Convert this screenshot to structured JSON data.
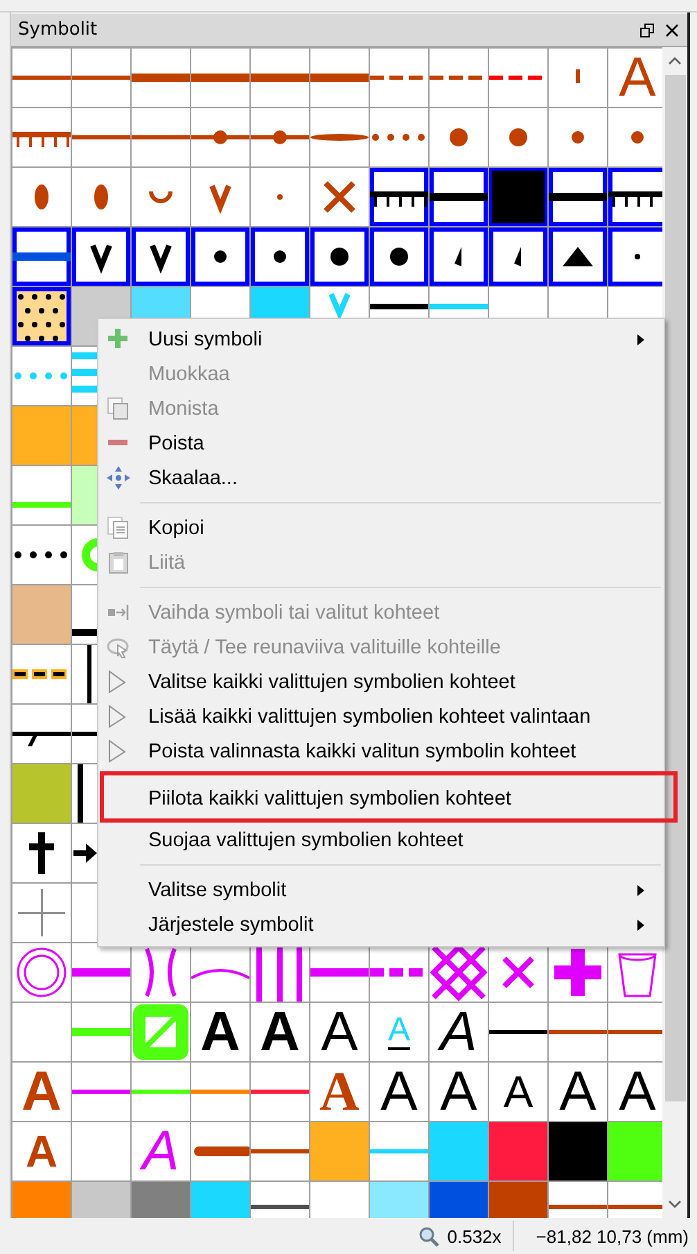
{
  "panel": {
    "title": "Symbolit"
  },
  "symbols": [
    [
      {
        "kind": "line",
        "color": "#c04000",
        "selected": false
      },
      {
        "kind": "line",
        "color": "#c04000",
        "selected": false
      },
      {
        "kind": "thick-line",
        "color": "#c04000",
        "selected": false
      },
      {
        "kind": "thick-line",
        "color": "#c04000",
        "selected": false
      },
      {
        "kind": "thick-line",
        "color": "#c04000",
        "selected": false
      },
      {
        "kind": "thick-line",
        "color": "#c04000",
        "selected": false
      },
      {
        "kind": "dash",
        "color": "#c04000",
        "selected": false
      },
      {
        "kind": "dash",
        "color": "#c04000",
        "selected": false
      },
      {
        "kind": "dash",
        "color": "#ff0000",
        "selected": false
      },
      {
        "kind": "tick",
        "color": "#c04000",
        "selected": false
      },
      {
        "kind": "letter",
        "glyph": "A",
        "color": "#c04000",
        "selected": false
      }
    ],
    [
      {
        "kind": "comb",
        "color": "#c04000",
        "selected": false
      },
      {
        "kind": "line",
        "color": "#c04000",
        "selected": false
      },
      {
        "kind": "line",
        "color": "#c04000",
        "selected": false
      },
      {
        "kind": "bead-line",
        "color": "#c04000",
        "selected": false
      },
      {
        "kind": "bead-line",
        "color": "#c04000",
        "selected": false
      },
      {
        "kind": "lens",
        "color": "#c04000",
        "selected": false
      },
      {
        "kind": "dots",
        "color": "#c04000",
        "selected": false
      },
      {
        "kind": "big-dot",
        "color": "#c04000",
        "selected": false
      },
      {
        "kind": "big-dot",
        "color": "#c04000",
        "selected": false
      },
      {
        "kind": "dot",
        "color": "#c04000",
        "selected": false
      },
      {
        "kind": "dot",
        "color": "#c04000",
        "selected": false
      }
    ],
    [
      {
        "kind": "ellipse",
        "color": "#c04000",
        "selected": false
      },
      {
        "kind": "ellipse",
        "color": "#c04000",
        "selected": false
      },
      {
        "kind": "cup",
        "color": "#c04000",
        "selected": false
      },
      {
        "kind": "vee",
        "color": "#c04000",
        "selected": false
      },
      {
        "kind": "small-dot",
        "color": "#c04000",
        "selected": false
      },
      {
        "kind": "cross",
        "color": "#c04000",
        "selected": false
      },
      {
        "kind": "comb",
        "color": "#000000",
        "selected": true
      },
      {
        "kind": "thick-line",
        "color": "#000000",
        "selected": true
      },
      {
        "kind": "square",
        "color": "#000000",
        "selected": true
      },
      {
        "kind": "thick-line",
        "color": "#000000",
        "selected": true
      },
      {
        "kind": "comb",
        "color": "#000000",
        "selected": true
      }
    ],
    [
      {
        "kind": "thick-line",
        "color": "#0050e0",
        "selected": true
      },
      {
        "kind": "vee",
        "color": "#000000",
        "selected": true
      },
      {
        "kind": "vee",
        "color": "#000000",
        "selected": true
      },
      {
        "kind": "dot",
        "color": "#000000",
        "selected": true
      },
      {
        "kind": "dot",
        "color": "#000000",
        "selected": true
      },
      {
        "kind": "big-dot",
        "color": "#000000",
        "selected": true
      },
      {
        "kind": "big-dot",
        "color": "#000000",
        "selected": true
      },
      {
        "kind": "small-triangle",
        "color": "#000000",
        "selected": true
      },
      {
        "kind": "small-triangle",
        "color": "#000000",
        "selected": true
      },
      {
        "kind": "triangle",
        "color": "#000000",
        "selected": true
      },
      {
        "kind": "small-dot",
        "color": "#000000",
        "selected": true
      }
    ],
    [
      {
        "kind": "pattern-fill",
        "color": "#ffd890",
        "selected": true
      },
      {
        "kind": "fill",
        "color": "#cccccc",
        "selected": false
      },
      {
        "kind": "fill",
        "color": "#55ddff",
        "selected": false
      },
      {
        "kind": "blank",
        "selected": false
      },
      {
        "kind": "fill",
        "color": "#1ad8ff",
        "selected": false
      },
      {
        "kind": "high-vee",
        "color": "#1ad8ff",
        "selected": false
      },
      {
        "kind": "top-line",
        "color": "#000000",
        "selected": false
      },
      {
        "kind": "top-line",
        "color": "#1ad8ff",
        "selected": false
      },
      {
        "kind": "blank",
        "selected": false
      },
      {
        "kind": "blank",
        "selected": false
      },
      {
        "kind": "blank",
        "selected": false
      }
    ],
    [
      {
        "kind": "dots",
        "color": "#1ad8ff",
        "selected": false
      },
      {
        "kind": "stripes",
        "color": "#1ad8ff",
        "selected": false
      }
    ],
    [
      {
        "kind": "fill",
        "color": "#ffb020",
        "selected": false
      },
      {
        "kind": "fill",
        "color": "#ffb020",
        "selected": false
      }
    ],
    [
      {
        "kind": "low-line",
        "color": "#50ff10",
        "selected": false
      },
      {
        "kind": "fill",
        "color": "#c8ffb8",
        "selected": false
      }
    ],
    [
      {
        "kind": "dots",
        "color": "#000000",
        "selected": false
      },
      {
        "kind": "half-ring",
        "color": "#50ff10",
        "selected": false
      }
    ],
    [
      {
        "kind": "fill",
        "color": "#e6b88a",
        "selected": false
      },
      {
        "kind": "bottom-line",
        "color": "#000000",
        "selected": false
      }
    ],
    [
      {
        "kind": "dash-border",
        "color": "#ffb020",
        "selected": false
      },
      {
        "kind": "bar",
        "color": "#000000",
        "selected": false
      }
    ],
    [
      {
        "kind": "scarp",
        "color": "#000000",
        "selected": false
      },
      {
        "kind": "line",
        "color": "#000000",
        "selected": false
      }
    ],
    [
      {
        "kind": "fill",
        "color": "#b8c42c",
        "selected": false
      },
      {
        "kind": "vstripes",
        "color": "#000000",
        "selected": false
      }
    ],
    [
      {
        "kind": "dagger",
        "color": "#000000",
        "selected": false
      },
      {
        "kind": "arrow",
        "color": "#000000",
        "selected": false
      }
    ],
    [
      {
        "kind": "thin-plus",
        "color": "#909090",
        "selected": false
      },
      {
        "kind": "blank",
        "selected": false
      }
    ],
    [
      {
        "kind": "ring",
        "color": "#e000ff",
        "selected": false
      },
      {
        "kind": "thick-line",
        "color": "#e000ff",
        "selected": false
      },
      {
        "kind": "brackets",
        "color": "#e000ff",
        "selected": false
      },
      {
        "kind": "arc",
        "color": "#e000ff",
        "selected": false
      },
      {
        "kind": "vstripes",
        "color": "#e000ff",
        "selected": false
      },
      {
        "kind": "thick-line",
        "color": "#e000ff",
        "selected": false
      },
      {
        "kind": "thick-dash",
        "color": "#e000ff",
        "selected": false
      },
      {
        "kind": "crosshatch",
        "color": "#e000ff",
        "selected": false
      },
      {
        "kind": "cross",
        "color": "#e000ff",
        "selected": false
      },
      {
        "kind": "plus",
        "color": "#e000ff",
        "selected": false
      },
      {
        "kind": "bucket",
        "color": "#e000ff",
        "selected": false
      }
    ],
    [
      {
        "kind": "blank",
        "selected": false
      },
      {
        "kind": "thick-line",
        "color": "#50ff10",
        "selected": false
      },
      {
        "kind": "box",
        "color": "#50ff10",
        "selected": false
      },
      {
        "kind": "bold-letter",
        "glyph": "A",
        "color": "#000000",
        "selected": false
      },
      {
        "kind": "bold-letter",
        "glyph": "A",
        "color": "#000000",
        "selected": false
      },
      {
        "kind": "letter",
        "glyph": "A",
        "color": "#000000",
        "selected": false
      },
      {
        "kind": "underlined-letter",
        "glyph": "A",
        "color": "#1ad8ff",
        "selected": false
      },
      {
        "kind": "italic-letter",
        "glyph": "A",
        "color": "#000000",
        "selected": false
      },
      {
        "kind": "line",
        "color": "#000000",
        "selected": false
      },
      {
        "kind": "line",
        "color": "#c04000",
        "selected": false
      },
      {
        "kind": "line",
        "color": "#c04000",
        "selected": false
      }
    ],
    [
      {
        "kind": "bold-letter",
        "glyph": "A",
        "color": "#c04000",
        "selected": false
      },
      {
        "kind": "line",
        "color": "#e000ff",
        "selected": false
      },
      {
        "kind": "line",
        "color": "#50ff10",
        "selected": false
      },
      {
        "kind": "line",
        "color": "#ff8000",
        "selected": false
      },
      {
        "kind": "line",
        "color": "#ff2040",
        "selected": false
      },
      {
        "kind": "serif-letter",
        "glyph": "A",
        "color": "#c04000",
        "selected": false
      },
      {
        "kind": "letter",
        "glyph": "A",
        "color": "#000000",
        "selected": false
      },
      {
        "kind": "letter",
        "glyph": "A",
        "color": "#000000",
        "selected": false
      },
      {
        "kind": "small-letter",
        "glyph": "A",
        "color": "#000000",
        "selected": false
      },
      {
        "kind": "letter",
        "glyph": "A",
        "color": "#000000",
        "selected": false
      },
      {
        "kind": "letter",
        "glyph": "A",
        "color": "#000000",
        "selected": false
      }
    ],
    [
      {
        "kind": "small-bold-letter",
        "glyph": "A",
        "color": "#c04000",
        "selected": false
      },
      {
        "kind": "blank",
        "selected": false
      },
      {
        "kind": "italic-letter",
        "glyph": "A",
        "color": "#e000ff",
        "selected": false
      },
      {
        "kind": "round-line",
        "color": "#c04000",
        "selected": false
      },
      {
        "kind": "line",
        "color": "#c04000",
        "selected": false
      },
      {
        "kind": "fill",
        "color": "#ffb020",
        "selected": false
      },
      {
        "kind": "line",
        "color": "#1ad8ff",
        "selected": false
      },
      {
        "kind": "fill",
        "color": "#1ad8ff",
        "selected": false
      },
      {
        "kind": "fill",
        "color": "#ff1a40",
        "selected": false
      },
      {
        "kind": "fill",
        "color": "#000000",
        "selected": false
      },
      {
        "kind": "fill",
        "color": "#50ff10",
        "selected": false
      }
    ],
    [
      {
        "kind": "fill",
        "color": "#ff8000",
        "selected": false
      },
      {
        "kind": "fill",
        "color": "#c8c8c8",
        "selected": false
      },
      {
        "kind": "fill",
        "color": "#808080",
        "selected": false
      },
      {
        "kind": "fill",
        "color": "#1ad8ff",
        "selected": false
      },
      {
        "kind": "upper-line",
        "color": "#505050",
        "selected": false
      },
      {
        "kind": "blank",
        "selected": false
      },
      {
        "kind": "fill",
        "color": "#8ae8ff",
        "selected": false
      },
      {
        "kind": "fill",
        "color": "#0050e0",
        "selected": false
      },
      {
        "kind": "fill",
        "color": "#c04000",
        "selected": false
      },
      {
        "kind": "upper-line",
        "color": "#c04000",
        "selected": false
      },
      {
        "kind": "upper-line",
        "color": "#c04000",
        "selected": false
      }
    ]
  ],
  "menu": {
    "items": [
      {
        "kind": "item",
        "label": "Uusi symboli",
        "disabled": false,
        "submenu": true,
        "annotated": false
      },
      {
        "kind": "item",
        "label": "Muokkaa",
        "disabled": true,
        "submenu": false,
        "annotated": false
      },
      {
        "kind": "item",
        "label": "Monista",
        "disabled": true,
        "submenu": false,
        "annotated": false
      },
      {
        "kind": "item",
        "label": "Poista",
        "disabled": false,
        "submenu": false,
        "annotated": false
      },
      {
        "kind": "item",
        "label": "Skaalaa...",
        "disabled": false,
        "submenu": false,
        "annotated": false
      },
      {
        "kind": "separator"
      },
      {
        "kind": "item",
        "label": "Kopioi",
        "disabled": false,
        "submenu": false,
        "annotated": false
      },
      {
        "kind": "item",
        "label": "Liitä",
        "disabled": true,
        "submenu": false,
        "annotated": false
      },
      {
        "kind": "separator"
      },
      {
        "kind": "item",
        "label": "Vaihda symboli tai valitut kohteet",
        "disabled": true,
        "submenu": false,
        "annotated": false
      },
      {
        "kind": "item",
        "label": "Täytä / Tee reunaviiva valituille kohteille",
        "disabled": true,
        "submenu": false,
        "annotated": false
      },
      {
        "kind": "item",
        "label": "Valitse kaikki valittujen symbolien kohteet",
        "disabled": false,
        "submenu": false,
        "annotated": false
      },
      {
        "kind": "item",
        "label": "Lisää kaikki valittujen symbolien kohteet valintaan",
        "disabled": false,
        "submenu": false,
        "annotated": false
      },
      {
        "kind": "item",
        "label": "Poista valinnasta kaikki valitun symbolin kohteet",
        "disabled": false,
        "submenu": false,
        "annotated": false
      },
      {
        "kind": "item",
        "label": "Piilota kaikki valittujen symbolien kohteet",
        "disabled": false,
        "submenu": false,
        "annotated": true
      },
      {
        "kind": "item",
        "label": "Suojaa valittujen symbolien kohteet",
        "disabled": false,
        "submenu": false,
        "annotated": false
      },
      {
        "kind": "separator"
      },
      {
        "kind": "item",
        "label": "Valitse symbolit",
        "disabled": false,
        "submenu": true,
        "annotated": false
      },
      {
        "kind": "item",
        "label": "Järjestele symbolit",
        "disabled": false,
        "submenu": true,
        "annotated": false
      }
    ]
  },
  "status_bar": {
    "zoom": "0.532x",
    "coordinates": "−81,82 10,73 (mm)"
  }
}
